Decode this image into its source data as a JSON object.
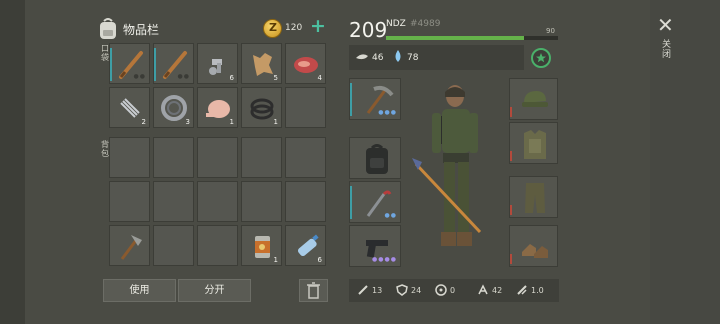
{
  "inventory": {
    "title": "物品栏",
    "coins": "120",
    "plus": "+",
    "section_top": "口袋",
    "section_bottom": "背包",
    "pocket_counts": [
      "",
      "",
      "6",
      "5",
      "4",
      "2",
      "3",
      "1",
      "1"
    ],
    "backpack_counts": [
      "1",
      "6"
    ],
    "use_button": "使用",
    "split_button": "分开"
  },
  "player": {
    "level": "209",
    "name": "NDZ",
    "id": "#4989",
    "xp_max": "90",
    "xp_fraction": 0.8,
    "food": "46",
    "water": "78"
  },
  "stats": {
    "attack": "13",
    "defense": "24",
    "radiation": "0",
    "speed": "42",
    "rate": "1.0"
  },
  "close_label": "关闭",
  "colors": {
    "xp_bar": "#65b24a",
    "accent": "#4cc0a0",
    "durability_teal": "#3e9ea6",
    "durability_red": "#b34a3c"
  }
}
